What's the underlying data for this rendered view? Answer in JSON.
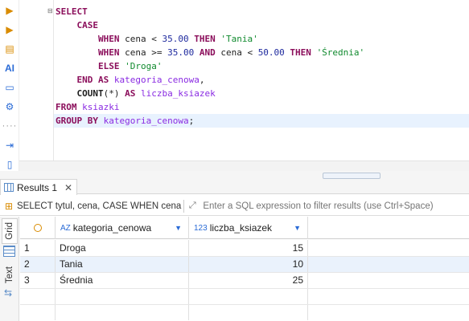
{
  "toolbar": {
    "icons": [
      "play-icon",
      "play-script-icon",
      "explain-plan-icon",
      "ai-assistant-icon",
      "terminal-icon",
      "settings-icon",
      "more-icon",
      "export-icon",
      "format-icon"
    ],
    "ai_label": "AI"
  },
  "editor": {
    "lines": [
      [
        {
          "t": "SELECT",
          "c": "kw"
        }
      ],
      [
        {
          "t": "    CASE",
          "c": "kw"
        }
      ],
      [
        {
          "t": "        WHEN ",
          "c": "kw"
        },
        {
          "t": "cena < ",
          "c": "plain"
        },
        {
          "t": "35.00",
          "c": "num"
        },
        {
          "t": " THEN ",
          "c": "kw"
        },
        {
          "t": "'Tania'",
          "c": "str"
        }
      ],
      [
        {
          "t": "        WHEN ",
          "c": "kw"
        },
        {
          "t": "cena >= ",
          "c": "plain"
        },
        {
          "t": "35.00",
          "c": "num"
        },
        {
          "t": " AND ",
          "c": "kw"
        },
        {
          "t": "cena < ",
          "c": "plain"
        },
        {
          "t": "50.00",
          "c": "num"
        },
        {
          "t": " THEN ",
          "c": "kw"
        },
        {
          "t": "'Średnia'",
          "c": "str"
        }
      ],
      [
        {
          "t": "        ELSE ",
          "c": "kw"
        },
        {
          "t": "'Droga'",
          "c": "str"
        }
      ],
      [
        {
          "t": "    END AS ",
          "c": "kw"
        },
        {
          "t": "kategoria_cenowa",
          "c": "id"
        },
        {
          "t": ",",
          "c": "plain"
        }
      ],
      [
        {
          "t": "    COUNT",
          "c": "fn"
        },
        {
          "t": "(*) ",
          "c": "plain"
        },
        {
          "t": "AS ",
          "c": "kw"
        },
        {
          "t": "liczba_ksiazek",
          "c": "id"
        }
      ],
      [
        {
          "t": "FROM ",
          "c": "kw"
        },
        {
          "t": "ksiazki",
          "c": "id"
        }
      ],
      [
        {
          "t": "GROUP BY ",
          "c": "kw"
        },
        {
          "t": "kategoria_cenowa",
          "c": "id"
        },
        {
          "t": ";",
          "c": "plain"
        }
      ]
    ],
    "current_line": 8
  },
  "results": {
    "tab_label": "Results 1",
    "close_glyph": "✕",
    "filter": {
      "query_text": "SELECT tytul, cena, CASE WHEN cena",
      "placeholder": "Enter a SQL expression to filter results (use Ctrl+Space)"
    },
    "side_tabs": {
      "grid": "Grid",
      "text": "Text"
    },
    "columns": [
      {
        "type": "AZ",
        "name": "kategoria_cenowa"
      },
      {
        "type": "123",
        "name": "liczba_ksiazek"
      }
    ],
    "rows": [
      {
        "n": "1",
        "kategoria_cenowa": "Droga",
        "liczba_ksiazek": "15"
      },
      {
        "n": "2",
        "kategoria_cenowa": "Tania",
        "liczba_ksiazek": "10"
      },
      {
        "n": "3",
        "kategoria_cenowa": "Średnia",
        "liczba_ksiazek": "25"
      }
    ]
  }
}
